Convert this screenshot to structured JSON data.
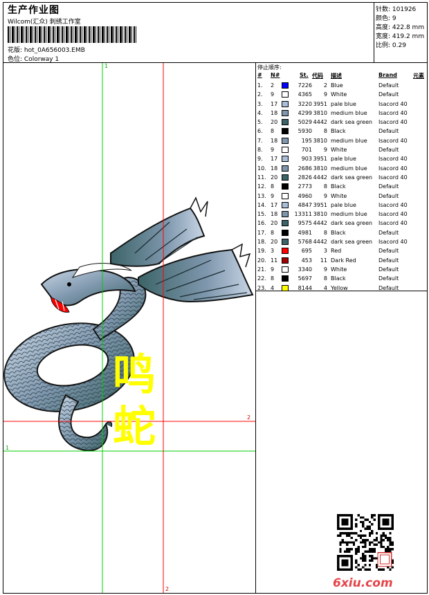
{
  "header": {
    "title": "生产作业图",
    "company": "Wilcom(汇众) 刺绣工作室",
    "design_label": "花版:",
    "design_value": "hot_0A656003.EMB",
    "colorway_label": "色位:",
    "colorway_value": "Colorway 1"
  },
  "stats": [
    {
      "label": "针数:",
      "value": "101926"
    },
    {
      "label": "颜色:",
      "value": "9"
    },
    {
      "label": "高度:",
      "value": "422.8 mm"
    },
    {
      "label": "宽度:",
      "value": "419.2 mm"
    },
    {
      "label": "比例:",
      "value": "0.29"
    }
  ],
  "guides": {
    "v1_label": "1",
    "v2_label": "2",
    "h1_label": "1",
    "h2_label": "2"
  },
  "artwork": {
    "text_line1": "鸣",
    "text_line2": "蛇"
  },
  "thread_table": {
    "stop_sequence_title": "停止顺序:",
    "headers": {
      "index": "#",
      "needle": "N#",
      "stitches": "St.",
      "code": "代码",
      "description": "描述",
      "brand": "Brand",
      "element": "元素"
    },
    "rows": [
      {
        "index": "1.",
        "needle": "2",
        "color": "#0000ff",
        "stitches": "7226",
        "code": "2",
        "description": "Blue",
        "brand": "Default"
      },
      {
        "index": "2.",
        "needle": "9",
        "color": "#ffffff",
        "stitches": "4365",
        "code": "9",
        "description": "White",
        "brand": "Default"
      },
      {
        "index": "3.",
        "needle": "17",
        "color": "#a9bfd8",
        "stitches": "3220",
        "code": "3951",
        "description": "pale blue",
        "brand": "Isacord 40"
      },
      {
        "index": "4.",
        "needle": "18",
        "color": "#7f97ad",
        "stitches": "4299",
        "code": "3810",
        "description": "medium blue",
        "brand": "Isacord 40"
      },
      {
        "index": "5.",
        "needle": "20",
        "color": "#3c6468",
        "stitches": "5029",
        "code": "4442",
        "description": "dark sea green",
        "brand": "Isacord 40"
      },
      {
        "index": "6.",
        "needle": "8",
        "color": "#000000",
        "stitches": "5930",
        "code": "8",
        "description": "Black",
        "brand": "Default"
      },
      {
        "index": "7.",
        "needle": "18",
        "color": "#7f97ad",
        "stitches": "195",
        "code": "3810",
        "description": "medium blue",
        "brand": "Isacord 40"
      },
      {
        "index": "8.",
        "needle": "9",
        "color": "#ffffff",
        "stitches": "701",
        "code": "9",
        "description": "White",
        "brand": "Default"
      },
      {
        "index": "9.",
        "needle": "17",
        "color": "#a9bfd8",
        "stitches": "903",
        "code": "3951",
        "description": "pale blue",
        "brand": "Isacord 40"
      },
      {
        "index": "10.",
        "needle": "18",
        "color": "#7f97ad",
        "stitches": "2686",
        "code": "3810",
        "description": "medium blue",
        "brand": "Isacord 40"
      },
      {
        "index": "11.",
        "needle": "20",
        "color": "#3c6468",
        "stitches": "2826",
        "code": "4442",
        "description": "dark sea green",
        "brand": "Isacord 40"
      },
      {
        "index": "12.",
        "needle": "8",
        "color": "#000000",
        "stitches": "2773",
        "code": "8",
        "description": "Black",
        "brand": "Default"
      },
      {
        "index": "13.",
        "needle": "9",
        "color": "#ffffff",
        "stitches": "4960",
        "code": "9",
        "description": "White",
        "brand": "Default"
      },
      {
        "index": "14.",
        "needle": "17",
        "color": "#a9bfd8",
        "stitches": "4847",
        "code": "3951",
        "description": "pale blue",
        "brand": "Isacord 40"
      },
      {
        "index": "15.",
        "needle": "18",
        "color": "#7f97ad",
        "stitches": "13311",
        "code": "3810",
        "description": "medium blue",
        "brand": "Isacord 40"
      },
      {
        "index": "16.",
        "needle": "20",
        "color": "#3c6468",
        "stitches": "9575",
        "code": "4442",
        "description": "dark sea green",
        "brand": "Isacord 40"
      },
      {
        "index": "17.",
        "needle": "8",
        "color": "#000000",
        "stitches": "4981",
        "code": "8",
        "description": "Black",
        "brand": "Default"
      },
      {
        "index": "18.",
        "needle": "20",
        "color": "#3c6468",
        "stitches": "5768",
        "code": "4442",
        "description": "dark sea green",
        "brand": "Isacord 40"
      },
      {
        "index": "19.",
        "needle": "3",
        "color": "#ff0000",
        "stitches": "695",
        "code": "3",
        "description": "Red",
        "brand": "Default"
      },
      {
        "index": "20.",
        "needle": "11",
        "color": "#a00000",
        "stitches": "453",
        "code": "11",
        "description": "Dark Red",
        "brand": "Default"
      },
      {
        "index": "21.",
        "needle": "9",
        "color": "#ffffff",
        "stitches": "3340",
        "code": "9",
        "description": "White",
        "brand": "Default"
      },
      {
        "index": "22.",
        "needle": "8",
        "color": "#000000",
        "stitches": "5697",
        "code": "8",
        "description": "Black",
        "brand": "Default"
      },
      {
        "index": "23.",
        "needle": "4",
        "color": "#ffff00",
        "stitches": "8144",
        "code": "4",
        "description": "Yellow",
        "brand": "Default"
      }
    ]
  },
  "footer": {
    "site_logo": "6xiu.com",
    "qr_icon": "qr-code-icon"
  },
  "colors": {
    "guide_green": "#00cc00",
    "guide_red": "#ff0000",
    "text_yellow": "#ffff00",
    "logo_red": "#e5444a"
  }
}
